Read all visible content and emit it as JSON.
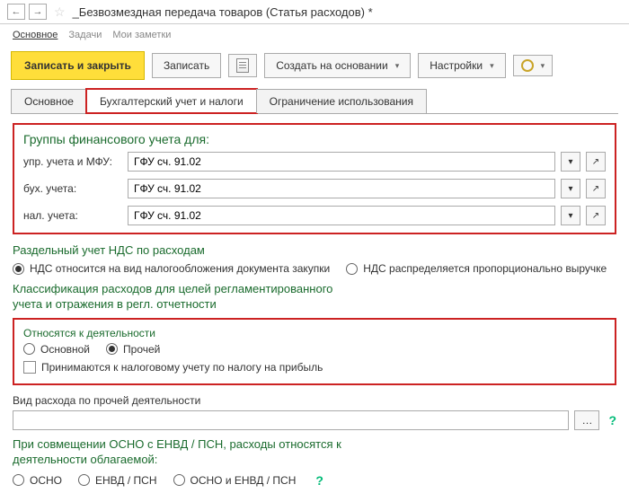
{
  "header": {
    "title": "_Безвозмездная передача товаров (Статья расходов) *"
  },
  "subnav": {
    "main": "Основное",
    "tasks": "Задачи",
    "notes": "Мои заметки"
  },
  "toolbar": {
    "save_close": "Записать и закрыть",
    "save": "Записать",
    "create_based": "Создать на основании",
    "settings": "Настройки"
  },
  "tabs": {
    "main": "Основное",
    "accounting": "Бухгалтерский учет и налоги",
    "restriction": "Ограничение использования"
  },
  "group_fin": {
    "title": "Группы финансового учета для:",
    "row1_label": "упр. учета и МФУ:",
    "row1_value": "ГФУ сч. 91.02",
    "row2_label": "бух. учета:",
    "row2_value": "ГФУ сч. 91.02",
    "row3_label": "нал. учета:",
    "row3_value": "ГФУ сч. 91.02"
  },
  "vat_section": {
    "title": "Раздельный учет НДС по расходам",
    "opt1": "НДС относится на вид налогообложения документа закупки",
    "opt2": "НДС распределяется пропорционально выручке"
  },
  "classification": {
    "title": "Классификация расходов для целей регламентированного учета и отражения в регл. отчетности",
    "activity_label": "Относятся к деятельности",
    "opt_main": "Основной",
    "opt_other": "Прочей",
    "checkbox_label": "Принимаются к налоговому учету по налогу на прибыль"
  },
  "expense_type": {
    "label": "Вид расхода по прочей деятельности",
    "value": ""
  },
  "combine_section": {
    "title": "При совмещении ОСНО с ЕНВД / ПСН, расходы относятся к деятельности облагаемой:",
    "opt1": "ОСНО",
    "opt2": "ЕНВД / ПСН",
    "opt3": "ОСНО и ЕНВД / ПСН"
  }
}
